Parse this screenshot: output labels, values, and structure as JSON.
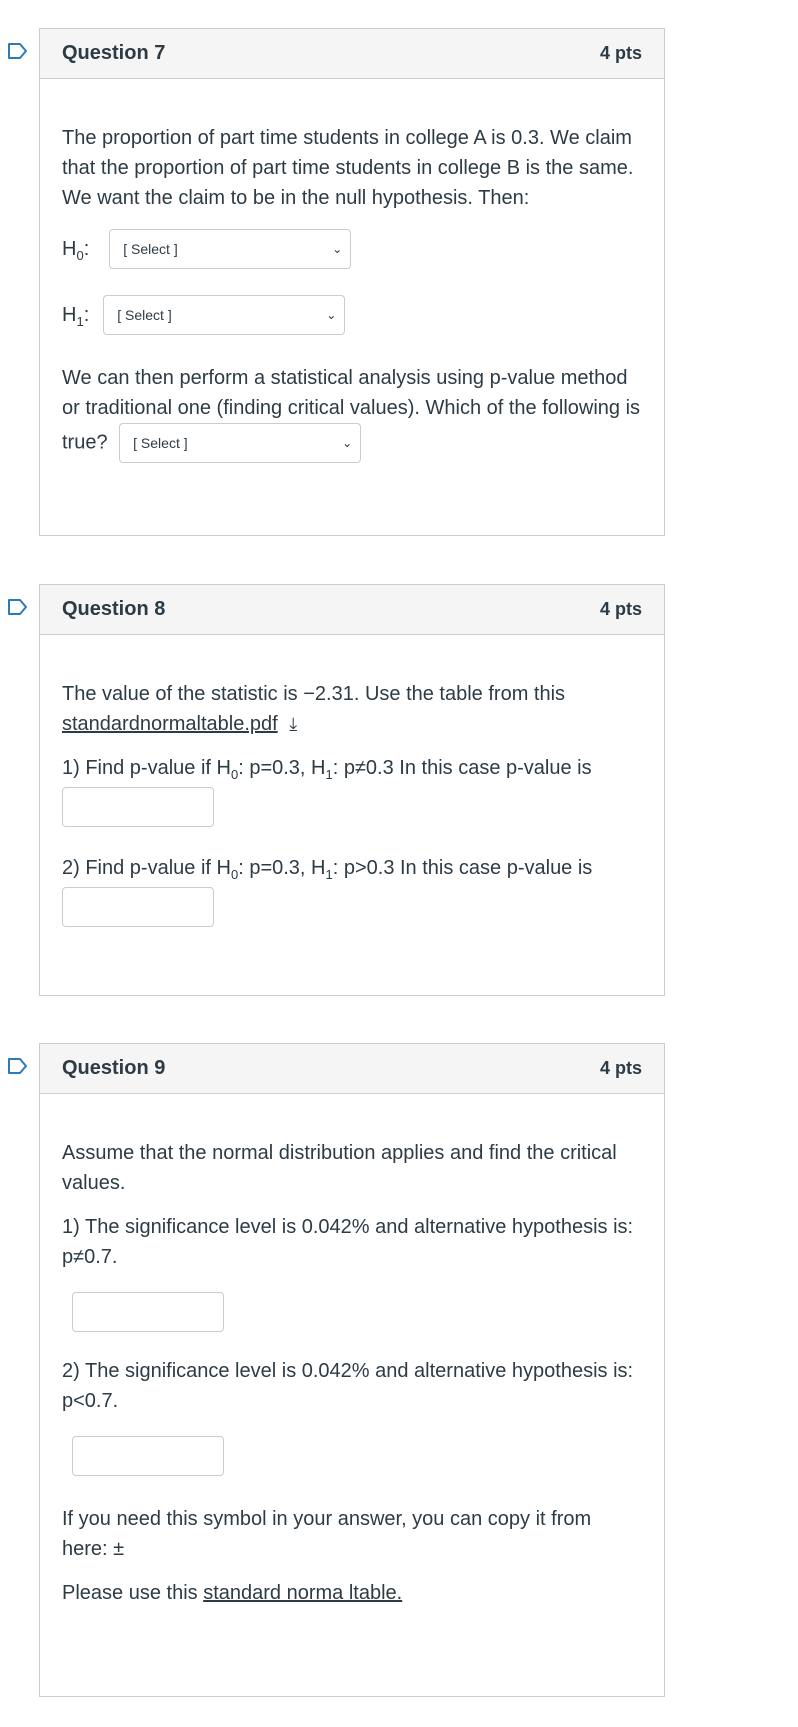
{
  "q7": {
    "title": "Question 7",
    "pts": "4 pts",
    "text": "The proportion of part time students in college A is 0.3. We claim  that the proportion of part time students in college B is the same. We want the claim to be in the null hypothesis. Then:",
    "h0_label": "H",
    "h0_sub": "0",
    "h1_label": "H",
    "h1_sub": "1",
    "select_placeholder": "[ Select ]",
    "text2": "We can then perform a statistical analysis using p-value method or traditional one (finding critical values). Which of the following is true?"
  },
  "q8": {
    "title": "Question 8",
    "pts": "4 pts",
    "text_pre": "The value of the statistic is −2.31. Use the table from this",
    "file_link": "standardnormaltable.pdf",
    "part1_pre": "1) Find p-value if  H",
    "part1_sub0": "0",
    "part1_mid": ": p=0.3, H",
    "part1_sub1": "1",
    "part1_post": ": p≠0.3  In this case p-value is",
    "part2_pre": "2) Find p-value if  H",
    "part2_sub0": "0",
    "part2_mid": ": p=0.3, H",
    "part2_sub1": "1",
    "part2_post": ": p>0.3  In this case p-value  is"
  },
  "q9": {
    "title": "Question 9",
    "pts": "4 pts",
    "text": "Assume that the normal distribution applies and find the critical values.",
    "part1": "1) The significance level is 0.042% and alternative hypothesis is: p≠0.7.",
    "part2": "2) The significance level is 0.042% and alternative hypothesis is: p<0.7.",
    "symbol_note": "If you need  this symbol in your answer, you can copy it from here: ±",
    "table_pre": "Please use this",
    "table_link": "standard norma ltable."
  },
  "colors": {
    "flag": "#2b7abc",
    "header_bg": "#f5f5f5",
    "border": "#c7cdd1",
    "text": "#2d3b45"
  },
  "icons": {
    "flag": "bookmark-flag-icon",
    "chevron": "chevron-down-icon",
    "download": "download-icon"
  }
}
